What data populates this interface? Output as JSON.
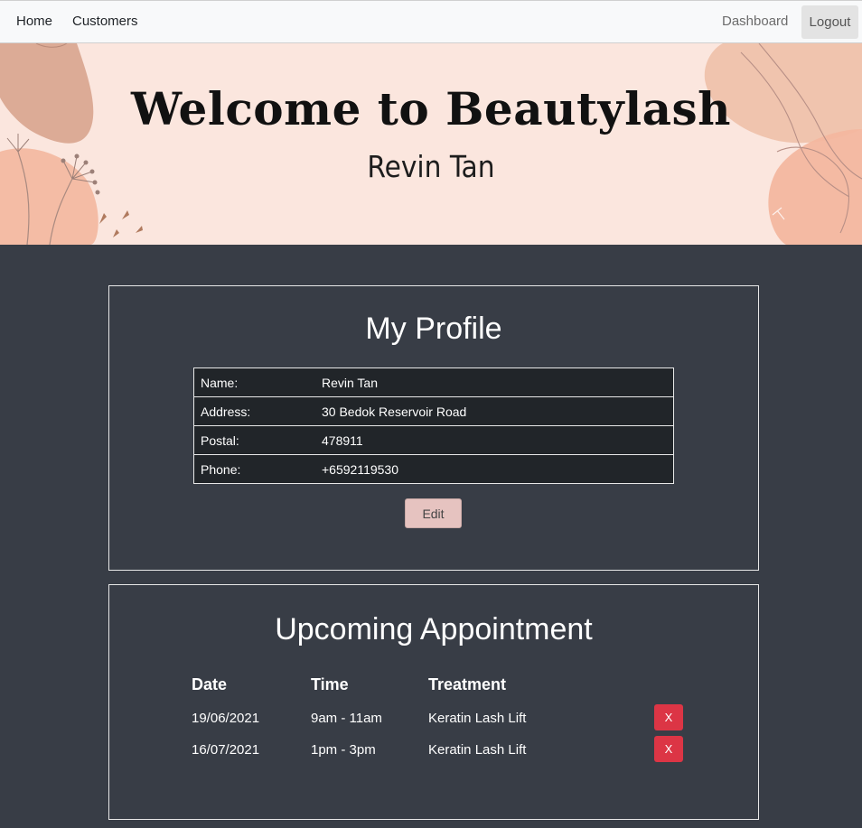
{
  "nav": {
    "home": "Home",
    "customers": "Customers",
    "dashboard": "Dashboard",
    "logout": "Logout"
  },
  "hero": {
    "title": "Welcome to Beautylash",
    "name": "Revin Tan"
  },
  "profile": {
    "title": "My Profile",
    "rows": [
      {
        "label": "Name:",
        "value": "Revin Tan"
      },
      {
        "label": "Address:",
        "value": "30 Bedok Reservoir Road"
      },
      {
        "label": "Postal:",
        "value": "478911"
      },
      {
        "label": "Phone:",
        "value": "+6592119530"
      }
    ],
    "edit_label": "Edit"
  },
  "appointments": {
    "title": "Upcoming Appointment",
    "headers": {
      "date": "Date",
      "time": "Time",
      "treatment": "Treatment"
    },
    "rows": [
      {
        "date": "19/06/2021",
        "time": "9am - 11am",
        "treatment": "Keratin Lash Lift",
        "delete_label": "X"
      },
      {
        "date": "16/07/2021",
        "time": "1pm - 3pm",
        "treatment": "Keratin Lash Lift",
        "delete_label": "X"
      }
    ]
  },
  "colors": {
    "page_bg": "#383d46",
    "hero_bg": "#fbe6de",
    "edit_button": "#e6c3c0",
    "delete_button": "#dc3545",
    "table_bg": "#212529"
  }
}
